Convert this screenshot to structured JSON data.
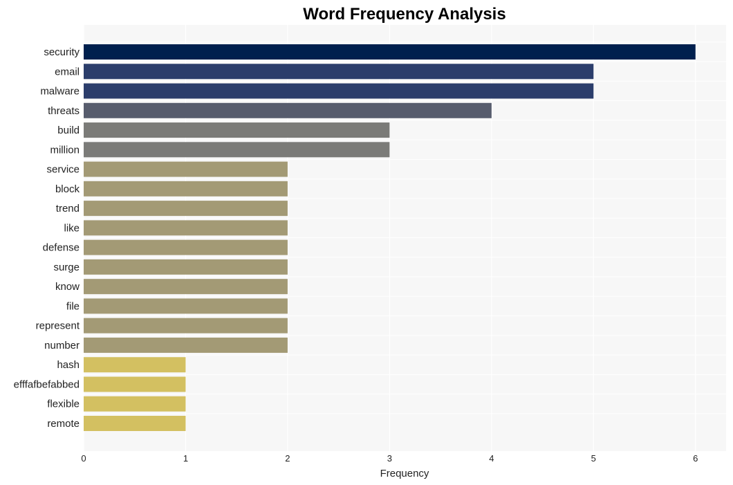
{
  "chart_data": {
    "type": "bar",
    "orientation": "horizontal",
    "title": "Word Frequency Analysis",
    "xlabel": "Frequency",
    "ylabel": "",
    "xlim": [
      0,
      6.3
    ],
    "xticks": [
      0,
      1,
      2,
      3,
      4,
      5,
      6
    ],
    "grid": true,
    "categories": [
      "security",
      "email",
      "malware",
      "threats",
      "build",
      "million",
      "service",
      "block",
      "trend",
      "like",
      "defense",
      "surge",
      "know",
      "file",
      "represent",
      "number",
      "hash",
      "efffafbefabbed",
      "flexible",
      "remote"
    ],
    "values": [
      6,
      5,
      5,
      4,
      3,
      3,
      2,
      2,
      2,
      2,
      2,
      2,
      2,
      2,
      2,
      2,
      1,
      1,
      1,
      1
    ],
    "colors": [
      "#00204e",
      "#2b3d6b",
      "#2b3d6b",
      "#575c6d",
      "#7b7b78",
      "#7b7b78",
      "#a39a75",
      "#a39a75",
      "#a39a75",
      "#a39a75",
      "#a39a75",
      "#a39a75",
      "#a39a75",
      "#a39a75",
      "#a39a75",
      "#a39a75",
      "#d3c061",
      "#d3c061",
      "#d3c061",
      "#d3c061"
    ],
    "plot_background": "#f7f7f7"
  }
}
